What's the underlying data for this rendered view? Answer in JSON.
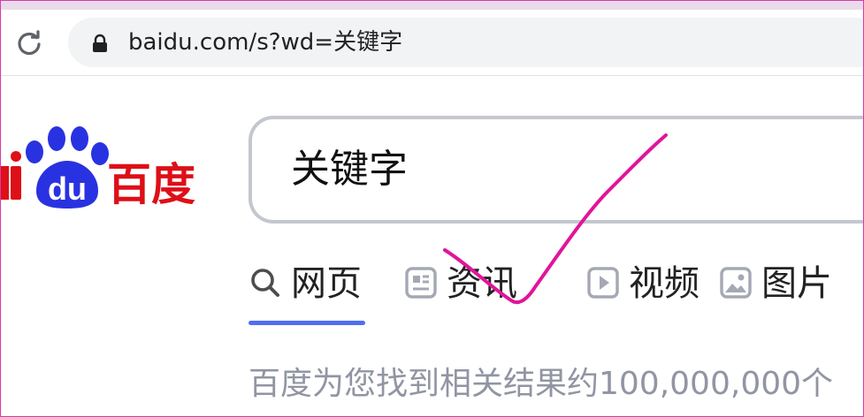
{
  "browser": {
    "url": "baidu.com/s?wd=关键字",
    "reload_icon": "reload-icon",
    "lock_icon": "lock-icon"
  },
  "logo": {
    "text_latin_partial": "i",
    "paw_text": "du",
    "chinese": "百度",
    "brand_red": "#de0f17",
    "brand_blue": "#2932e1"
  },
  "search": {
    "query": "关键字"
  },
  "tabs": [
    {
      "label": "网页",
      "icon": "search-icon",
      "active": true
    },
    {
      "label": "资讯",
      "icon": "news-icon",
      "active": false
    },
    {
      "label": "视频",
      "icon": "video-icon",
      "active": false
    },
    {
      "label": "图片",
      "icon": "image-icon",
      "active": false
    }
  ],
  "results": {
    "count_text": "百度为您找到相关结果约100,000,000个"
  },
  "colors": {
    "accent": "#4e6ef2",
    "annotation": "#e0159a",
    "muted_text": "#9195a3"
  }
}
